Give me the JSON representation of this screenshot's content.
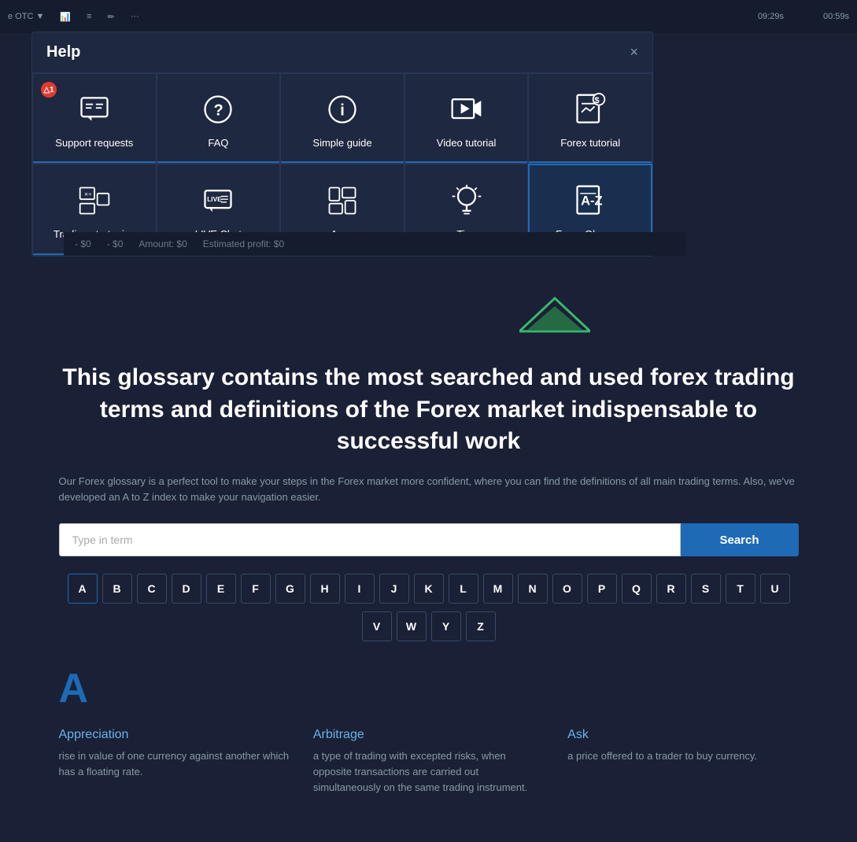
{
  "platform": {
    "symbol": "e OTC",
    "time1": "09:29s",
    "time2": "00:59s",
    "bottom_values": [
      "- $0",
      "- $0",
      "Amount: $0",
      "Estimated profit: $0"
    ]
  },
  "help": {
    "title": "Help",
    "close_label": "×",
    "notification_badge": "△1",
    "items": [
      {
        "id": "support-requests",
        "label": "Support requests",
        "icon": "chat-icon",
        "active": false,
        "has_notification": true
      },
      {
        "id": "faq",
        "label": "FAQ",
        "icon": "question-icon",
        "active": false,
        "has_notification": false
      },
      {
        "id": "simple-guide",
        "label": "Simple guide",
        "icon": "info-icon",
        "active": false,
        "has_notification": false
      },
      {
        "id": "video-tutorial",
        "label": "Video tutorial",
        "icon": "video-icon",
        "active": false,
        "has_notification": false
      },
      {
        "id": "forex-tutorial",
        "label": "Forex tutorial",
        "icon": "book-chart-icon",
        "active": false,
        "has_notification": false
      },
      {
        "id": "trading-strategies",
        "label": "Trading strategies",
        "icon": "strategy-icon",
        "active": false,
        "has_notification": false
      },
      {
        "id": "live-chat",
        "label": "LIVE Chat",
        "icon": "live-chat-icon",
        "active": false,
        "has_notification": false
      },
      {
        "id": "apps",
        "label": "Apps",
        "icon": "apps-icon",
        "active": false,
        "has_notification": false
      },
      {
        "id": "tips",
        "label": "Tips",
        "icon": "tips-icon",
        "active": false,
        "has_notification": false
      },
      {
        "id": "forex-glossary",
        "label": "Forex Glossary",
        "icon": "glossary-icon",
        "active": true,
        "has_notification": false
      }
    ]
  },
  "glossary": {
    "headline": "This glossary contains the most searched and used forex trading terms and definitions of the Forex market indispensable to successful work",
    "subtext": "Our Forex glossary is a perfect tool to make your steps in the Forex market more confident, where you can find the definitions of all main trading terms. Also, we've developed an A to Z index to make your navigation easier.",
    "search_placeholder": "Type in term",
    "search_button_label": "Search",
    "alphabet_row1": [
      "A",
      "B",
      "C",
      "D",
      "E",
      "F",
      "G",
      "H",
      "I",
      "J",
      "K",
      "L",
      "M",
      "N",
      "O",
      "P",
      "Q",
      "R",
      "S",
      "T",
      "U"
    ],
    "alphabet_row2": [
      "V",
      "W",
      "Y",
      "Z"
    ],
    "current_letter": "A",
    "terms": [
      {
        "name": "Appreciation",
        "definition": "rise in value of one currency against another which has a floating rate."
      },
      {
        "name": "Arbitrage",
        "definition": "a type of trading with excepted risks, when opposite transactions are carried out simultaneously on the same trading instrument."
      },
      {
        "name": "Ask",
        "definition": "a price offered to a trader to buy currency."
      }
    ]
  }
}
